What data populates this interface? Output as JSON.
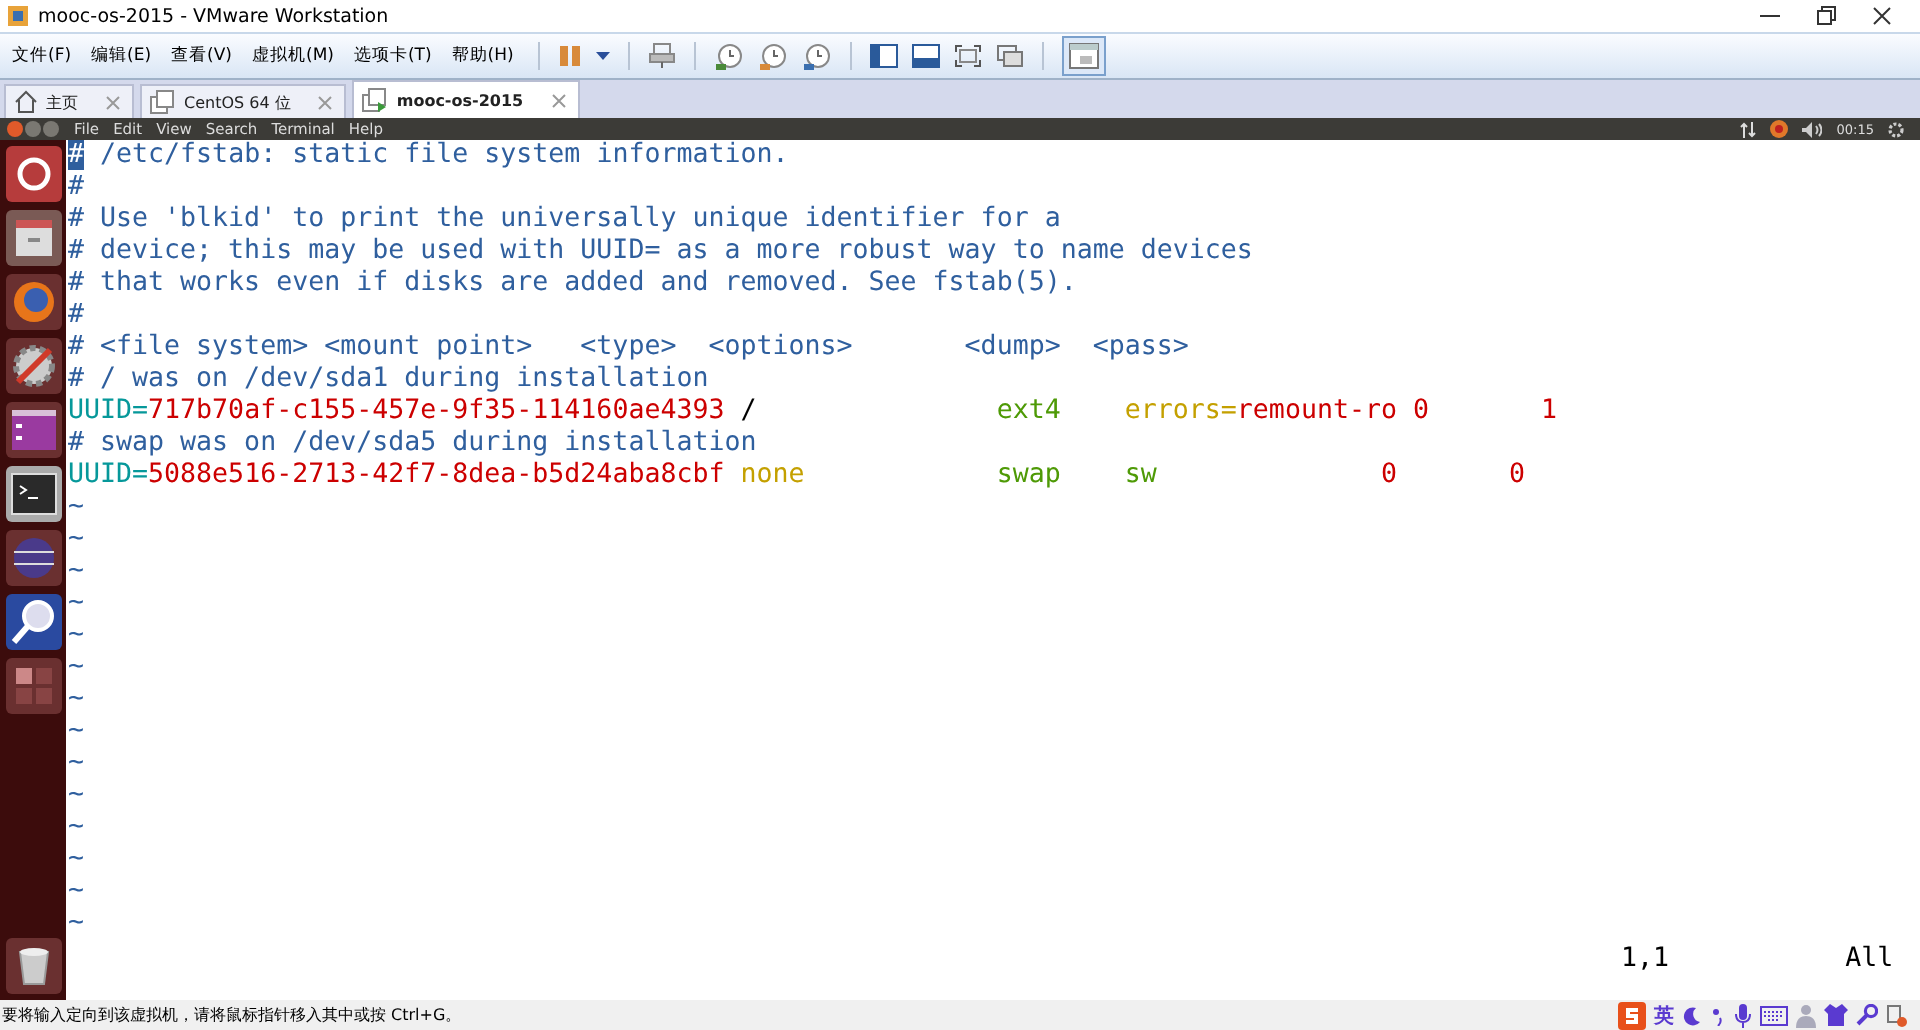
{
  "window": {
    "title": "mooc-os-2015 - VMware Workstation"
  },
  "menu": [
    "文件(F)",
    "编辑(E)",
    "查看(V)",
    "虚拟机(M)",
    "选项卡(T)",
    "帮助(H)"
  ],
  "tabs": [
    {
      "label": "主页",
      "kind": "home",
      "selected": false
    },
    {
      "label": "CentOS 64 位",
      "kind": "vm",
      "selected": false
    },
    {
      "label": "mooc-os-2015",
      "kind": "vm-running",
      "selected": true
    }
  ],
  "guest_menu": [
    "File",
    "Edit",
    "View",
    "Search",
    "Terminal",
    "Help"
  ],
  "guest_clock": "00:15",
  "editor": {
    "lines": [
      [
        {
          "kind": "cursor",
          "text": "#"
        },
        {
          "kind": "comment",
          "text": " /etc/fstab: static file system information."
        }
      ],
      [
        {
          "kind": "comment",
          "text": "#"
        }
      ],
      [
        {
          "kind": "comment",
          "text": "# Use 'blkid' to print the universally unique identifier for a"
        }
      ],
      [
        {
          "kind": "comment",
          "text": "# device; this may be used with UUID= as a more robust way to name devices"
        }
      ],
      [
        {
          "kind": "comment",
          "text": "# that works even if disks are added and removed. See fstab(5)."
        }
      ],
      [
        {
          "kind": "comment",
          "text": "#"
        }
      ],
      [
        {
          "kind": "comment",
          "text": "# <file system> <mount point>   <type>  <options>       <dump>  <pass>"
        }
      ],
      [
        {
          "kind": "comment",
          "text": "# / was on /dev/sda1 during installation"
        }
      ],
      [
        {
          "kind": "key",
          "text": "UUID="
        },
        {
          "kind": "value",
          "text": "717b70af-c155-457e-9f35-114160ae4393"
        },
        {
          "kind": "text",
          "text": " /               "
        },
        {
          "kind": "type",
          "text": "ext4    "
        },
        {
          "kind": "option",
          "text": "errors="
        },
        {
          "kind": "value",
          "text": "remount-ro 0       1"
        }
      ],
      [
        {
          "kind": "comment",
          "text": "# swap was on /dev/sda5 during installation"
        }
      ],
      [
        {
          "kind": "key",
          "text": "UUID="
        },
        {
          "kind": "value",
          "text": "5088e516-2713-42f7-8dea-b5d24aba8cbf "
        },
        {
          "kind": "option",
          "text": "none            "
        },
        {
          "kind": "type",
          "text": "swap    sw              "
        },
        {
          "kind": "value",
          "text": "0       0"
        }
      ]
    ],
    "tildes": [
      "~",
      "~",
      "~",
      "~",
      "~",
      "~",
      "~",
      "~",
      "~",
      "~",
      "~",
      "~",
      "~",
      "~"
    ],
    "ruler": "1,1",
    "position": "All"
  },
  "status_bar": {
    "message": "要将输入定向到该虚拟机，请将鼠标指针移入其中或按 Ctrl+G。",
    "ime": "英"
  }
}
